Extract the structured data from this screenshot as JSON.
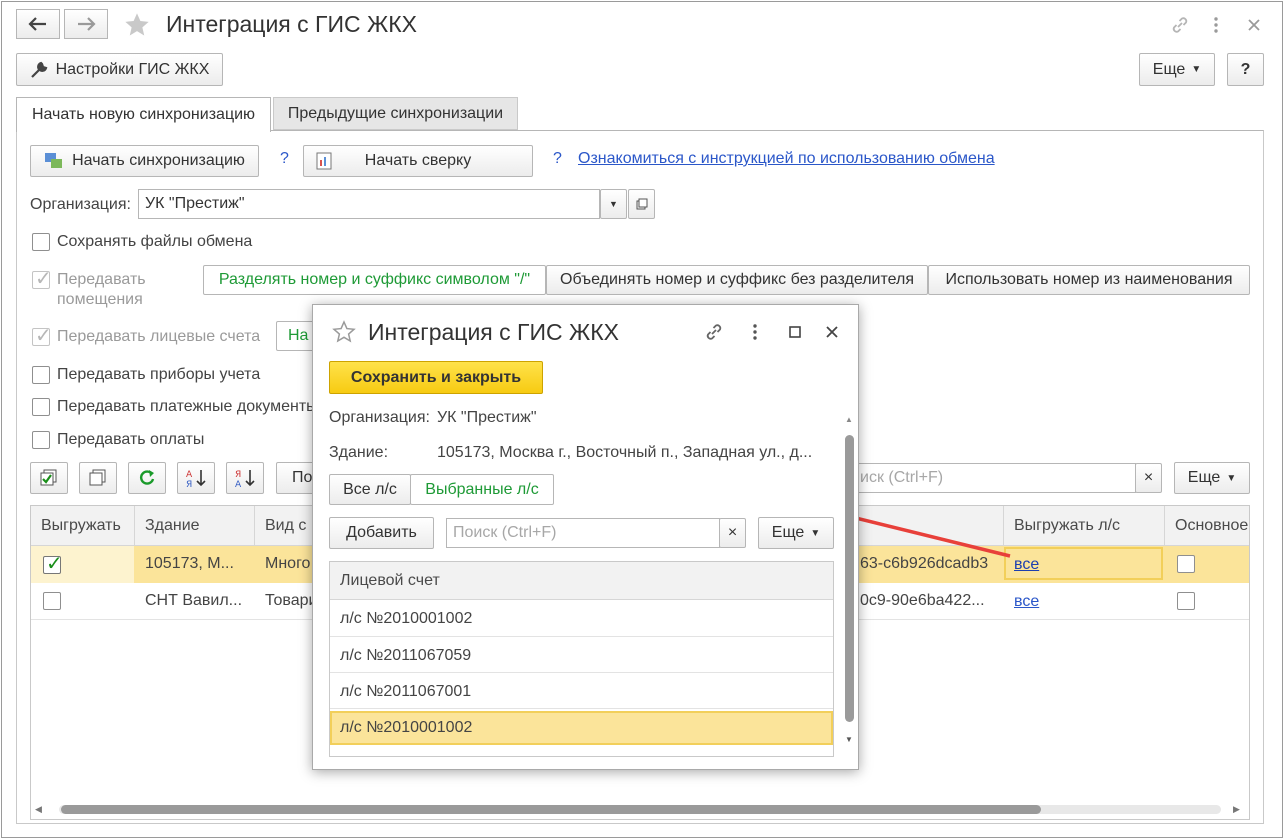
{
  "window": {
    "back_icon": "arrow-left-icon",
    "forward_icon": "arrow-right-icon",
    "favorite_icon": "star-icon",
    "title": "Интеграция с ГИС ЖКХ",
    "link_icon": "link-icon",
    "menu_icon": "vertical-dots-icon",
    "close_icon": "close-icon"
  },
  "toolbar": {
    "settings_label": "Настройки ГИС ЖКХ",
    "more_label": "Еще",
    "help_label": "?"
  },
  "tabs": [
    {
      "label": "Начать новую синхронизацию",
      "active": true
    },
    {
      "label": "Предыдущие синхронизации",
      "active": false
    }
  ],
  "actions": {
    "start_sync_label": "Начать синхронизацию",
    "help1": "?",
    "start_check_label": "Начать сверку",
    "help2": "?",
    "instruction_link": "Ознакомиться с инструкцией по использованию обмена"
  },
  "organization": {
    "label": "Организация:",
    "value": "УК \"Престиж\""
  },
  "options": {
    "save_files": "Сохранять файлы обмена",
    "transfer_rooms_line1": "Передавать",
    "transfer_rooms_line2": "помещения",
    "transfer_accounts": "Передавать лицевые счета",
    "transfer_meters": "Передавать приборы учета",
    "transfer_docs": "Передавать платежные документы",
    "transfer_payments": "Передавать оплаты"
  },
  "room_modes": [
    {
      "label": "Разделять номер и суффикс символом \"/\"",
      "selected": true
    },
    {
      "label": "Объединять номер и суффикс без разделителя",
      "selected": false
    },
    {
      "label": "Использовать номер из наименования",
      "selected": false
    }
  ],
  "account_mode_partial": "На",
  "list_toolbar": {
    "partial_button": "По",
    "search_placeholder": "иск (Ctrl+F)",
    "clear": "×",
    "more_label": "Еще"
  },
  "table": {
    "columns": [
      "Выгружать",
      "Здание",
      "Вид с",
      "",
      "Выгружать л/с",
      "Основное"
    ],
    "rows": [
      {
        "export": true,
        "building": "105173, М...",
        "kind": "Много",
        "guid": "63-c6b926dcadb3",
        "accounts": "все",
        "main": false,
        "selected": true
      },
      {
        "export": false,
        "building": "СНТ Вавил...",
        "kind": "Товари",
        "guid": "0c9-90e6ba422...",
        "accounts": "все",
        "main": false,
        "selected": false
      }
    ]
  },
  "popup": {
    "title": "Интеграция с ГИС ЖКХ",
    "save_close_label": "Сохранить и закрыть",
    "org_label": "Организация:",
    "org_value": "УК \"Престиж\"",
    "building_label": "Здание:",
    "building_value": "105173, Москва г., Восточный п., Западная ул., д...",
    "filter_all": "Все л/с",
    "filter_selected": "Выбранные л/с",
    "add_label": "Добавить",
    "search_placeholder": "Поиск (Ctrl+F)",
    "clear": "×",
    "more_label": "Еще",
    "column": "Лицевой счет",
    "accounts": [
      {
        "name": "л/с №2010001002",
        "selected": false
      },
      {
        "name": "л/с №2011067059",
        "selected": false
      },
      {
        "name": "л/с №2011067001",
        "selected": false
      },
      {
        "name": "л/с №2010001002",
        "selected": true
      }
    ]
  },
  "colors": {
    "accent_green": "#1e9a36",
    "link_blue": "#2b57c9",
    "selection_yellow": "#fbe49a",
    "primary_button": "#f7cb12",
    "arrow_red": "#e8403a"
  }
}
